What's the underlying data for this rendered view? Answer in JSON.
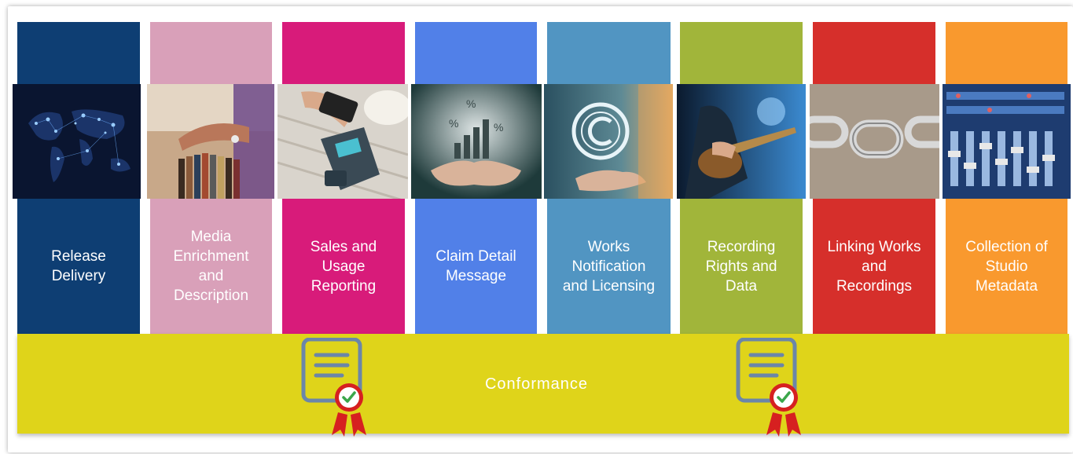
{
  "columns": [
    {
      "label": "Release\nDelivery",
      "color": "#0e3e73",
      "image": "world-map-network-image"
    },
    {
      "label": "Media\nEnrichment\nand\nDescription",
      "color": "#d9a0b9",
      "image": "vinyl-record-browsing-image"
    },
    {
      "label": "Sales and\nUsage\nReporting",
      "color": "#d81b7a",
      "image": "card-payment-terminal-image"
    },
    {
      "label": "Claim Detail\nMessage",
      "color": "#5180e8",
      "image": "hands-holding-percent-chart-image"
    },
    {
      "label": "Works\nNotification\nand Licensing",
      "color": "#5195c2",
      "image": "copyright-symbol-hand-image"
    },
    {
      "label": "Recording\nRights and\nData",
      "color": "#a1b53a",
      "image": "guitarist-performing-image"
    },
    {
      "label": "Linking Works\nand\nRecordings",
      "color": "#d62f2b",
      "image": "metal-chain-links-image"
    },
    {
      "label": "Collection of\nStudio\nMetadata",
      "color": "#f9992e",
      "image": "mixing-console-image"
    }
  ],
  "conformance": {
    "label": "Conformance",
    "color": "#dfd41a",
    "badge_icon": "certificate-badge-icon"
  }
}
